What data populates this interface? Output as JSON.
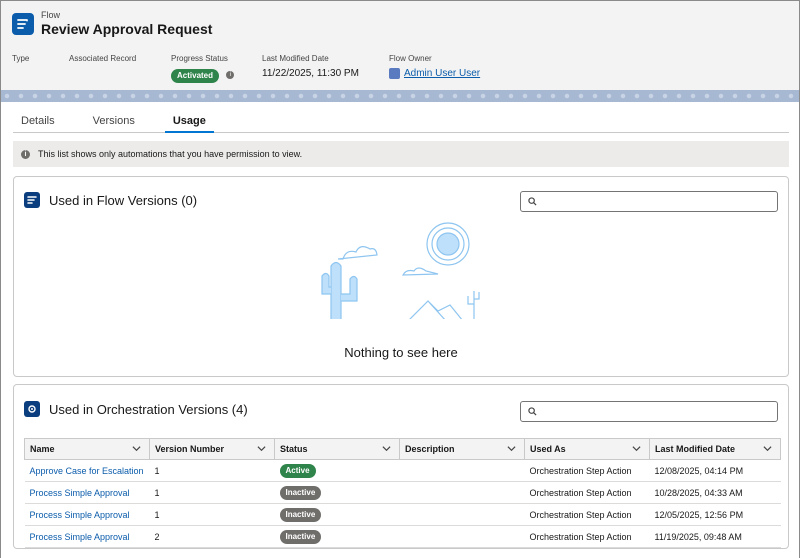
{
  "header": {
    "object_type": "Flow",
    "title": "Review Approval Request",
    "fields": {
      "type_label": "Type",
      "associated_record_label": "Associated Record",
      "progress_status_label": "Progress Status",
      "progress_status_value": "Activated",
      "last_modified_label": "Last Modified Date",
      "last_modified_value": "11/22/2025, 11:30 PM",
      "owner_label": "Flow Owner",
      "owner_value": "Admin User User"
    }
  },
  "tabs": [
    {
      "label": "Details",
      "active": false
    },
    {
      "label": "Versions",
      "active": false
    },
    {
      "label": "Usage",
      "active": true
    }
  ],
  "info_banner": "This list shows only automations that you have permission to view.",
  "flow_versions_card": {
    "title": "Used in Flow Versions (0)",
    "search_placeholder": "",
    "empty_message": "Nothing to see here"
  },
  "orchestration_card": {
    "title": "Used in Orchestration Versions (4)",
    "search_placeholder": "",
    "columns": [
      "Name",
      "Version Number",
      "Status",
      "Description",
      "Used As",
      "Last Modified Date"
    ],
    "rows": [
      {
        "name": "Approve Case for Escalation",
        "version": "1",
        "status": "Active",
        "description": "",
        "used_as": "Orchestration Step Action",
        "modified": "12/08/2025, 04:14 PM"
      },
      {
        "name": "Process Simple Approval",
        "version": "1",
        "status": "Inactive",
        "description": "",
        "used_as": "Orchestration Step Action",
        "modified": "10/28/2025, 04:33 AM"
      },
      {
        "name": "Process Simple Approval",
        "version": "1",
        "status": "Inactive",
        "description": "",
        "used_as": "Orchestration Step Action",
        "modified": "12/05/2025, 12:56 PM"
      },
      {
        "name": "Process Simple Approval",
        "version": "2",
        "status": "Inactive",
        "description": "",
        "used_as": "Orchestration Step Action",
        "modified": "11/19/2025, 09:48 AM"
      }
    ]
  },
  "colors": {
    "brand": "#0b5cab",
    "active_status": "#2e844a",
    "inactive_status": "#706e6b"
  }
}
